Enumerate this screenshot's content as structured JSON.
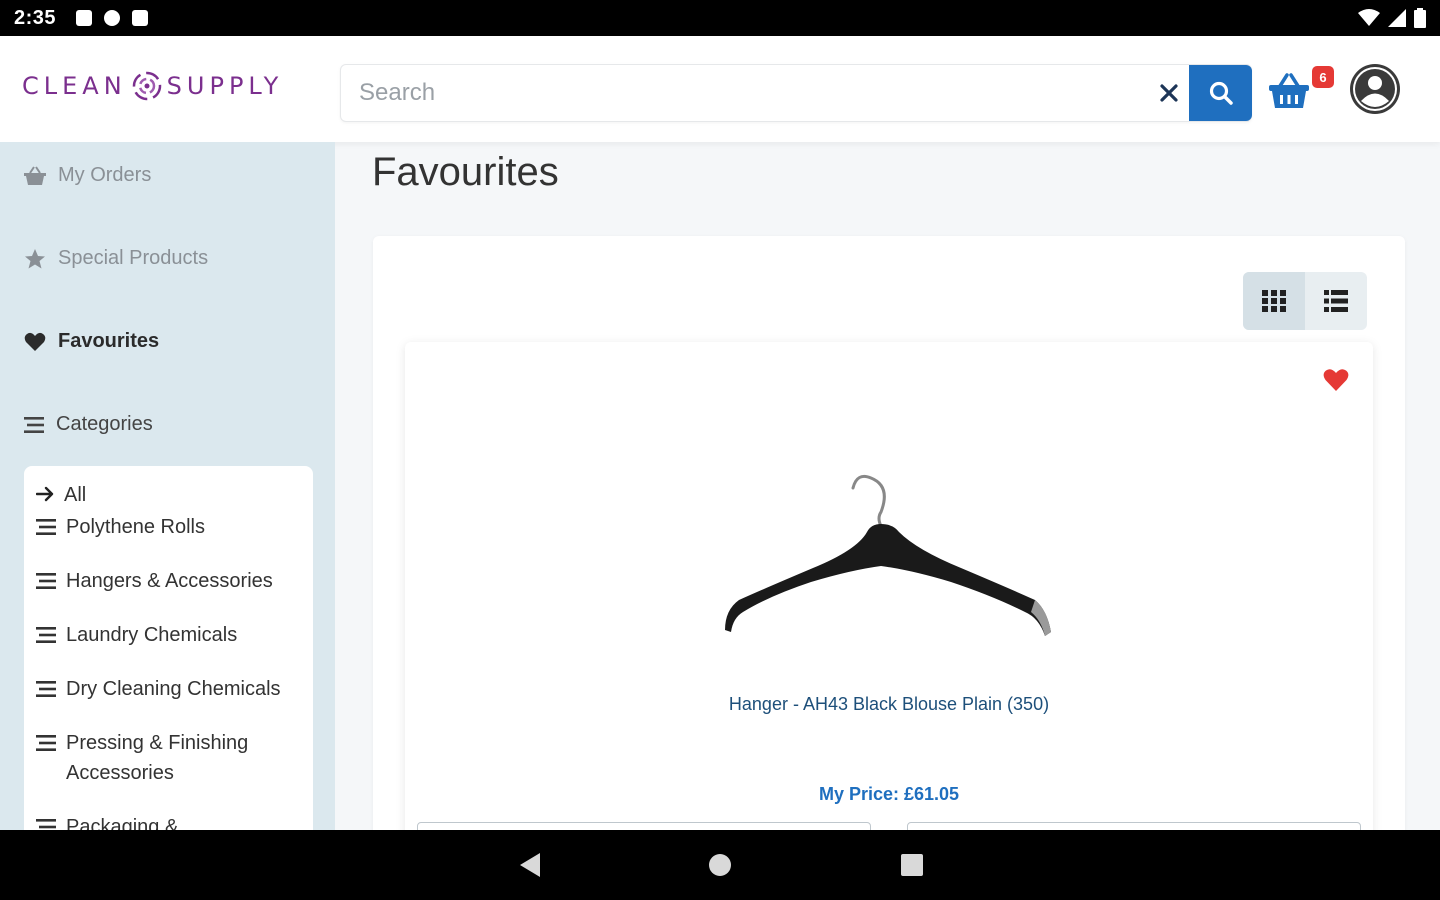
{
  "status_bar": {
    "time": "2:35"
  },
  "header": {
    "logo_left": "CLEAN",
    "logo_right": "SUPPLY",
    "search_placeholder": "Search",
    "cart_count": "6"
  },
  "sidebar": {
    "nav": [
      {
        "label": "My Orders",
        "icon": "basket-icon"
      },
      {
        "label": "Special Products",
        "icon": "star-icon"
      },
      {
        "label": "Favourites",
        "icon": "heart-icon"
      },
      {
        "label": "Categories",
        "icon": "list-icon"
      }
    ],
    "categories": [
      {
        "label": "All",
        "icon": "arrow-right-icon"
      },
      {
        "label": "Polythene Rolls",
        "icon": "list-icon"
      },
      {
        "label": "Hangers & Accessories",
        "icon": "list-icon"
      },
      {
        "label": "Laundry Chemicals",
        "icon": "list-icon"
      },
      {
        "label": "Dry Cleaning Chemicals",
        "icon": "list-icon"
      },
      {
        "label": "Pressing & Finishing Accessories",
        "icon": "list-icon"
      },
      {
        "label": "Packaging &",
        "icon": "list-icon"
      }
    ]
  },
  "main": {
    "title": "Favourites",
    "view_modes": [
      "grid-view-icon",
      "list-view-icon"
    ],
    "product": {
      "name": "Hanger - AH43 Black Blouse Plain (350)",
      "price": "My Price: £61.05",
      "favourited": true
    }
  },
  "colors": {
    "brand_purple": "#7b2f8e",
    "primary_blue": "#1f6fbf",
    "sidebar_bg": "#dbe8ee",
    "favourite_red": "#e53935"
  }
}
